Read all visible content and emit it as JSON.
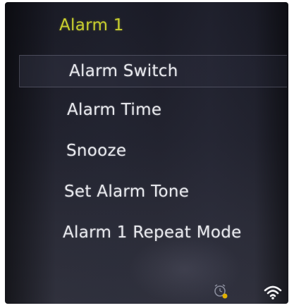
{
  "screen": {
    "title": "Alarm 1",
    "menu": [
      {
        "label": "Alarm Switch",
        "selected": true
      },
      {
        "label": "Alarm Time",
        "selected": false
      },
      {
        "label": "Snooze",
        "selected": false
      },
      {
        "label": "Set Alarm Tone",
        "selected": false
      },
      {
        "label": "Alarm 1 Repeat Mode",
        "selected": false
      }
    ]
  },
  "status_bar": {
    "icons": [
      "alarm-clock-icon",
      "wifi-icon"
    ]
  },
  "colors": {
    "title": "#c9cf2f",
    "menu_text": "#e8e9ee",
    "background": "#22232f",
    "alarm_badge": "#e0b000"
  }
}
